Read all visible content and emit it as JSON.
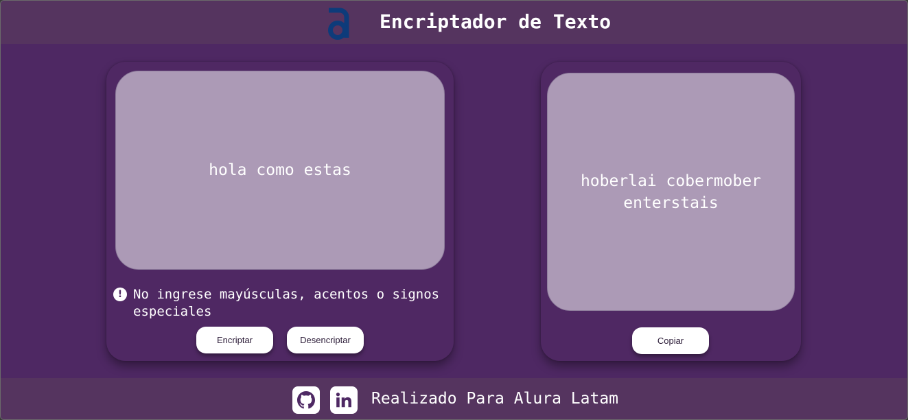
{
  "header": {
    "logo_icon": "alura-a-logo",
    "title": "Encriptador de Texto"
  },
  "input_panel": {
    "text": "hola como estas",
    "warning_icon": "exclamation-circle-icon",
    "warning": "No ingrese mayúsculas, acentos o signos especiales",
    "encrypt_label": "Encriptar",
    "decrypt_label": "Desencriptar"
  },
  "output_panel": {
    "text": "hoberlai cobermober enterstais",
    "copy_label": "Copiar"
  },
  "footer": {
    "github_icon": "github-icon",
    "linkedin_icon": "linkedin-icon",
    "text": "Realizado Para Alura Latam"
  },
  "colors": {
    "background": "#4e2863",
    "bar": "#55345f",
    "textbox": "#ac9ab6",
    "logo": "#0d3b7a",
    "button": "#ffffff"
  }
}
